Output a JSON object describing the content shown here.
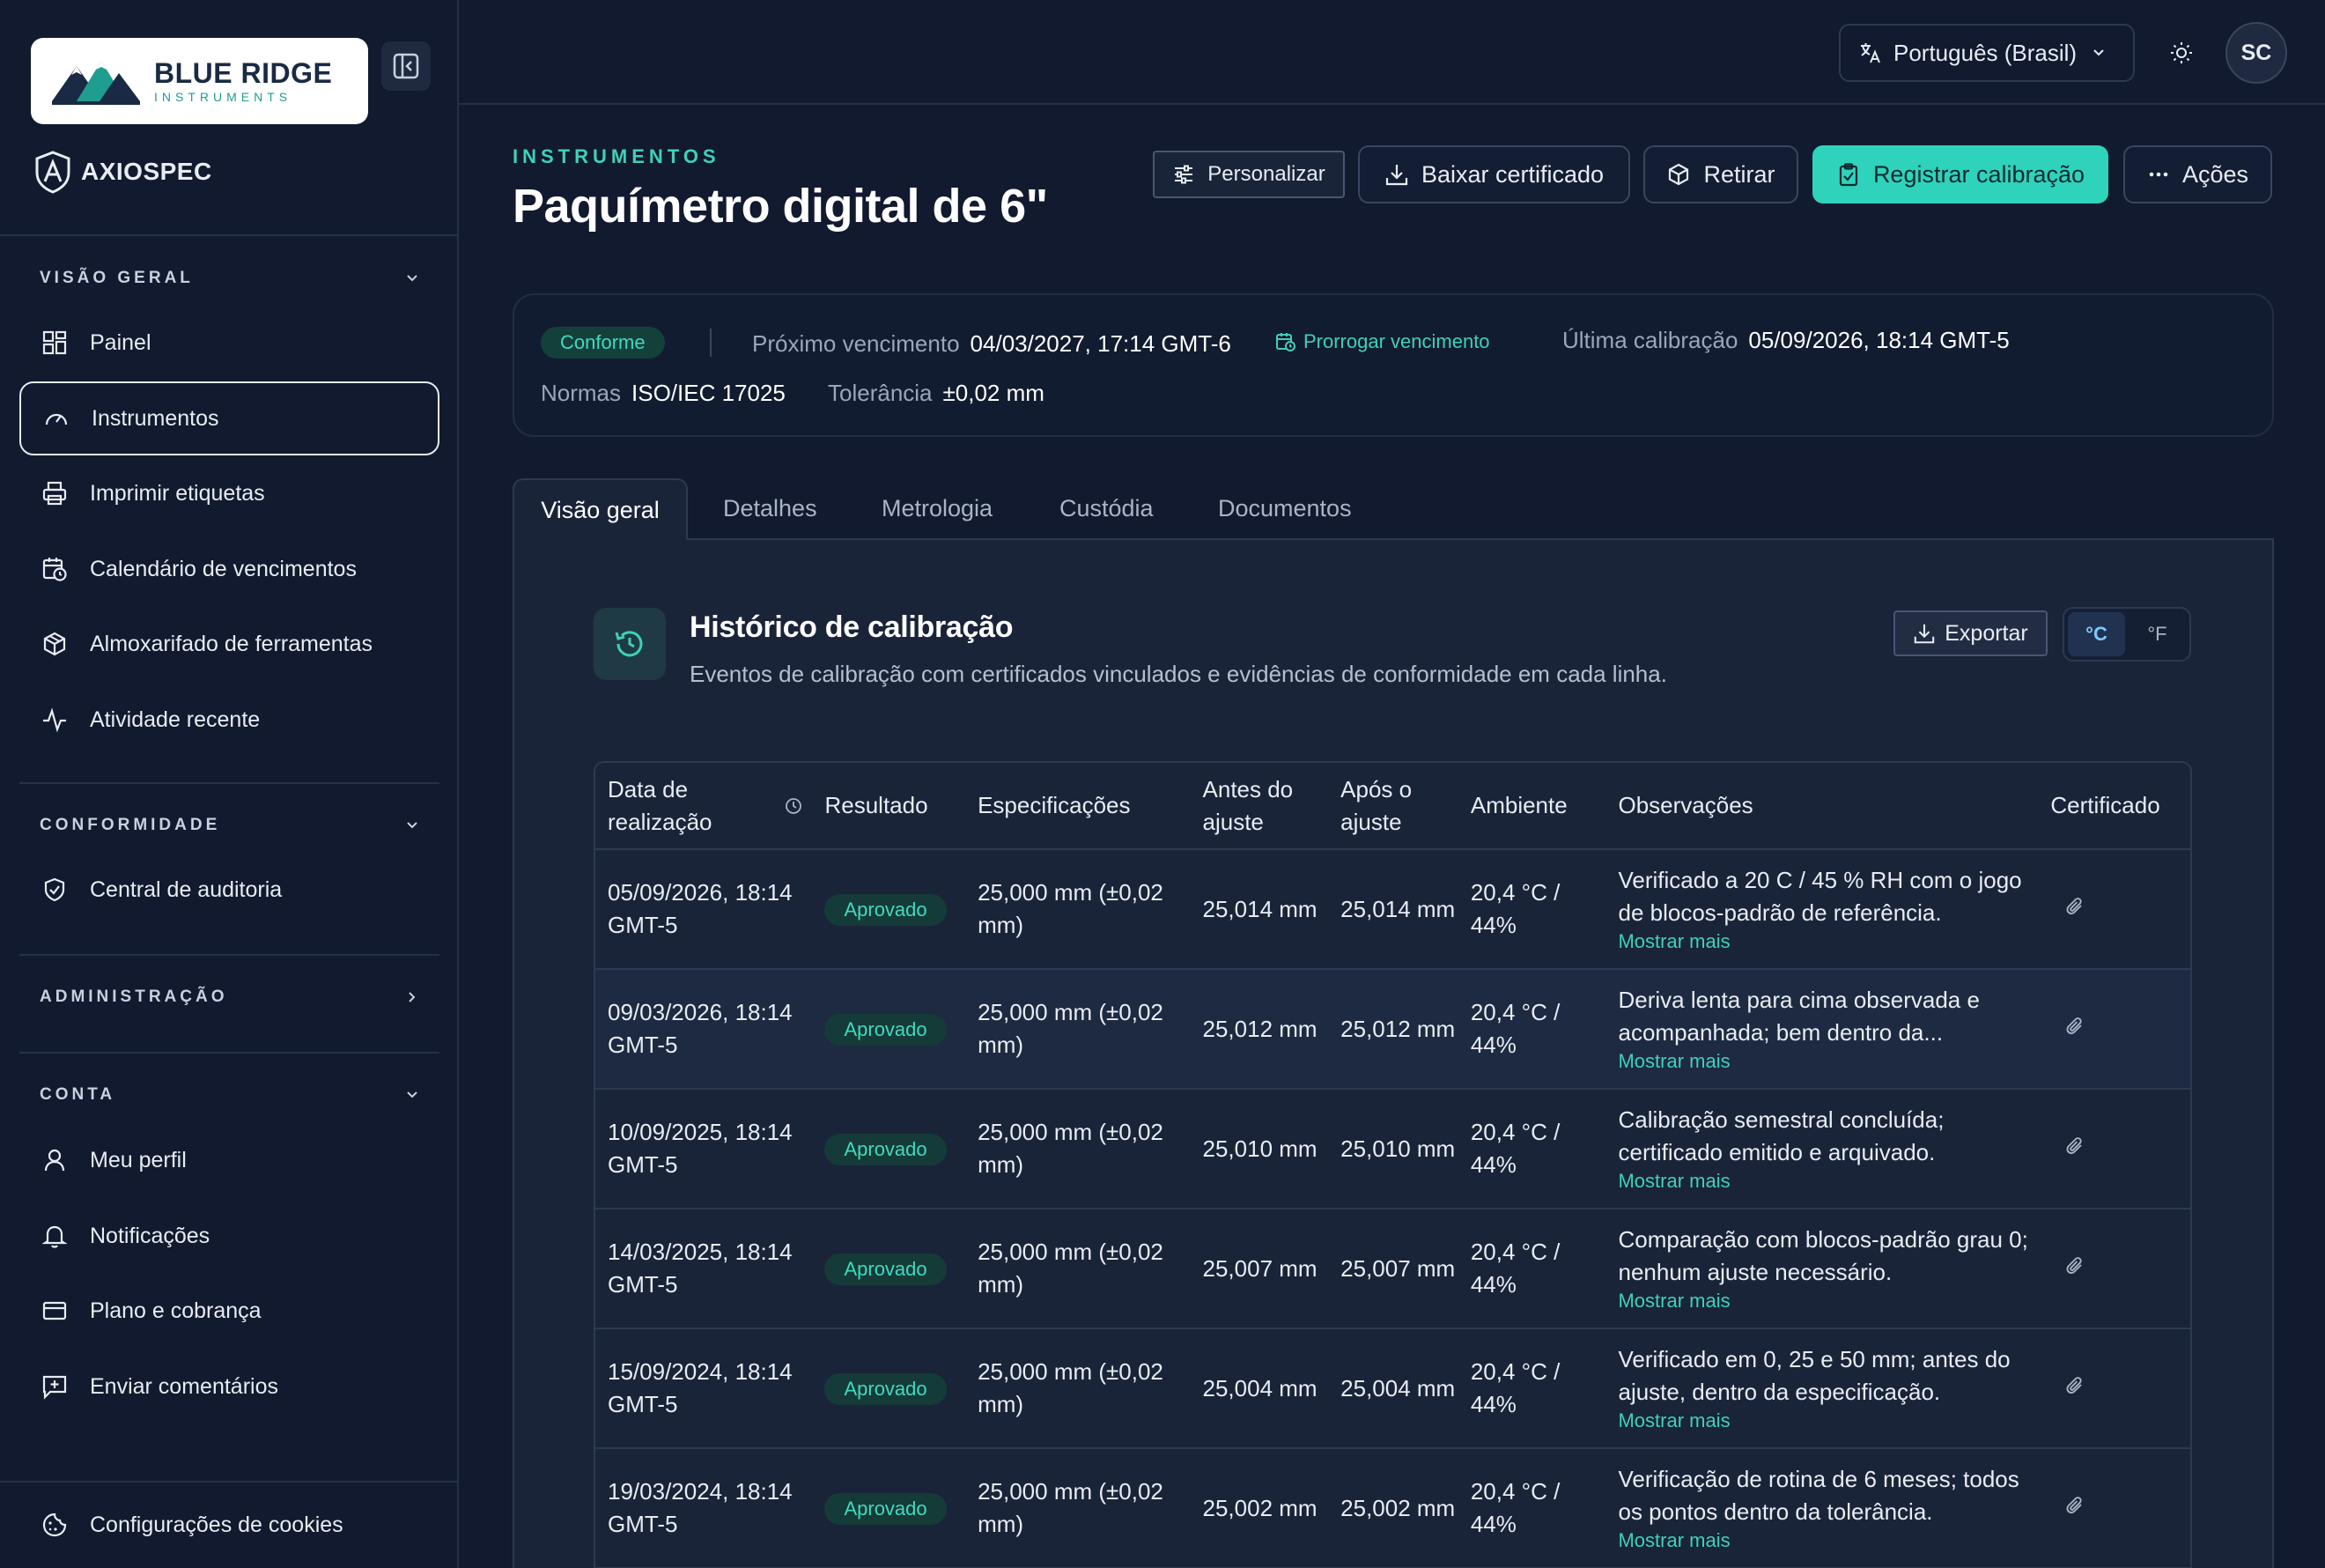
{
  "brand": {
    "logo_title": "BLUE RIDGE",
    "logo_subtitle": "INSTRUMENTS",
    "product": "AXIOSPEC"
  },
  "topbar": {
    "language": "Português (Brasil)",
    "avatar_initials": "SC"
  },
  "sidebar": {
    "sections": [
      {
        "title": "VISÃO GERAL",
        "items": [
          "Painel",
          "Instrumentos",
          "Imprimir etiquetas",
          "Calendário de vencimentos",
          "Almoxarifado de ferramentas",
          "Atividade recente"
        ]
      },
      {
        "title": "CONFORMIDADE",
        "items": [
          "Central de auditoria"
        ]
      },
      {
        "title": "ADMINISTRAÇÃO",
        "items": []
      },
      {
        "title": "CONTA",
        "items": [
          "Meu perfil",
          "Notificações",
          "Plano e cobrança",
          "Enviar comentários"
        ]
      }
    ],
    "active_item": "Instrumentos",
    "footer_item": "Configurações de cookies"
  },
  "header": {
    "eyebrow": "INSTRUMENTOS",
    "title": "Paquímetro digital de 6\"",
    "buttons": {
      "customize": "Personalizar",
      "download": "Baixar certificado",
      "checkout": "Retirar",
      "register": "Registrar calibração",
      "actions": "Ações"
    }
  },
  "summary": {
    "status": "Conforme",
    "next_due_label": "Próximo vencimento",
    "next_due_value": "04/03/2027, 17:14 GMT-6",
    "extend_label": "Prorrogar vencimento",
    "last_cal_label": "Última calibração",
    "last_cal_value": "05/09/2026, 18:14 GMT-5",
    "standards_label": "Normas",
    "standards_value": "ISO/IEC 17025",
    "tolerance_label": "Tolerância",
    "tolerance_value": "±0,02 mm"
  },
  "tabs": [
    "Visão geral",
    "Detalhes",
    "Metrologia",
    "Custódia",
    "Documentos"
  ],
  "history": {
    "title": "Histórico de calibração",
    "subtitle": "Eventos de calibração com certificados vinculados e evidências de conformidade em cada linha.",
    "export_label": "Exportar",
    "unit_c": "°C",
    "unit_f": "°F",
    "columns": [
      "Data de realização",
      "Resultado",
      "Especificações",
      "Antes do ajuste",
      "Após o ajuste",
      "Ambiente",
      "Observações",
      "Certificado"
    ],
    "show_more": "Mostrar mais",
    "rows": [
      {
        "date": "05/09/2026, 18:14 GMT-5",
        "result": "Aprovado",
        "spec": "25,000 mm (±0,02 mm)",
        "before": "25,014 mm",
        "after": "25,014 mm",
        "env": "20,4 °C / 44%",
        "notes": "Verificado a 20 C / 45 % RH com o jogo de blocos-padrão de referência."
      },
      {
        "date": "09/03/2026, 18:14 GMT-5",
        "result": "Aprovado",
        "spec": "25,000 mm (±0,02 mm)",
        "before": "25,012 mm",
        "after": "25,012 mm",
        "env": "20,4 °C / 44%",
        "notes": "Deriva lenta para cima observada e acompanhada; bem dentro da..."
      },
      {
        "date": "10/09/2025, 18:14 GMT-5",
        "result": "Aprovado",
        "spec": "25,000 mm (±0,02 mm)",
        "before": "25,010 mm",
        "after": "25,010 mm",
        "env": "20,4 °C / 44%",
        "notes": "Calibração semestral concluída; certificado emitido e arquivado."
      },
      {
        "date": "14/03/2025, 18:14 GMT-5",
        "result": "Aprovado",
        "spec": "25,000 mm (±0,02 mm)",
        "before": "25,007 mm",
        "after": "25,007 mm",
        "env": "20,4 °C / 44%",
        "notes": "Comparação com blocos-padrão grau 0; nenhum ajuste necessário."
      },
      {
        "date": "15/09/2024, 18:14 GMT-5",
        "result": "Aprovado",
        "spec": "25,000 mm (±0,02 mm)",
        "before": "25,004 mm",
        "after": "25,004 mm",
        "env": "20,4 °C / 44%",
        "notes": "Verificado em 0, 25 e 50 mm; antes do ajuste, dentro da especificação."
      },
      {
        "date": "19/03/2024, 18:14 GMT-5",
        "result": "Aprovado",
        "spec": "25,000 mm (±0,02 mm)",
        "before": "25,002 mm",
        "after": "25,002 mm",
        "env": "20,4 °C / 44%",
        "notes": "Verificação de rotina de 6 meses; todos os pontos dentro da tolerância."
      }
    ]
  },
  "colors": {
    "accent": "#2fd3bc",
    "background": "#111a2e",
    "panel": "#1a2439"
  }
}
